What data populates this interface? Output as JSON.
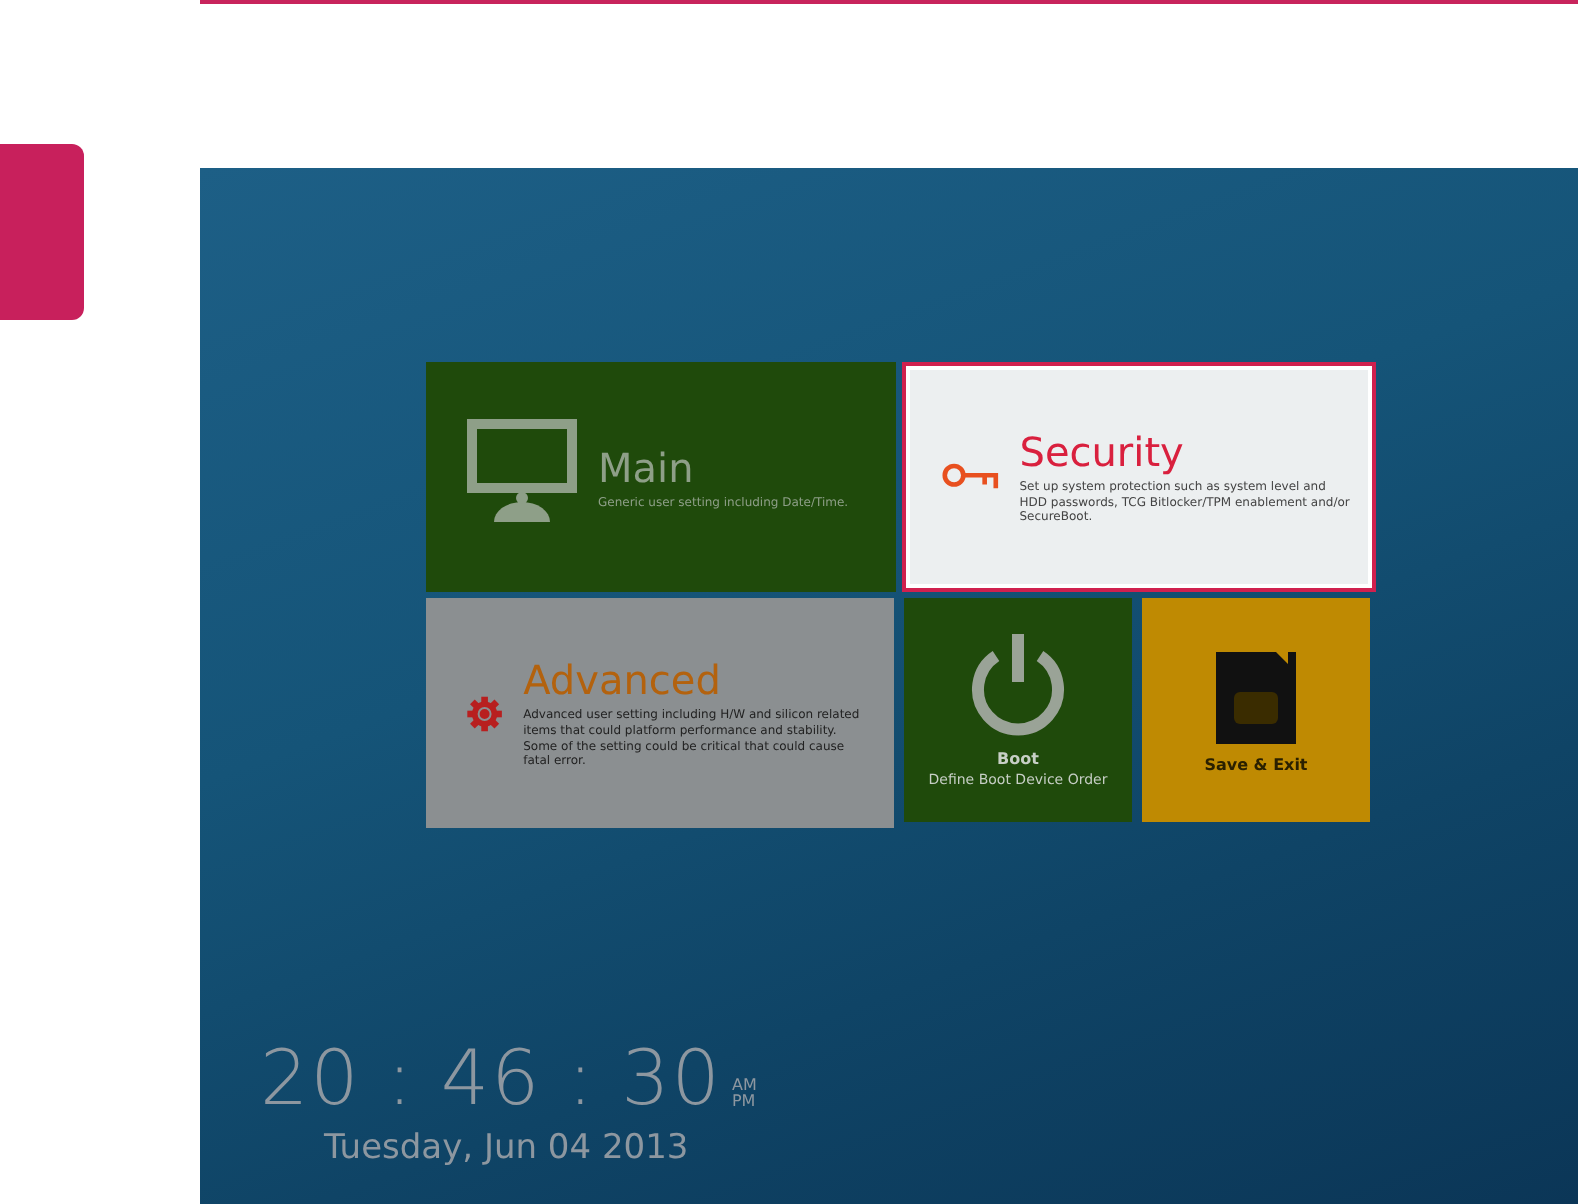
{
  "tiles": [
    {
      "kind": "wide",
      "title": "Main",
      "description": "Generic user setting including Date/Time.",
      "selected": false,
      "color": "#1f4a0b"
    },
    {
      "kind": "wide",
      "title": "Security",
      "description": "Set up system protection such as system level and HDD passwords, TCG Bitlocker/TPM enablement and/or SecureBoot.",
      "selected": true,
      "color": "#eceff0"
    },
    {
      "kind": "wide",
      "title": "Advanced",
      "description": "Advanced user setting including H/W and silicon related items that could platform performance and stability. Some of the setting could be critical that could cause fatal error.",
      "selected": false,
      "color": "#8b8f91"
    },
    {
      "kind": "small",
      "title": "Boot",
      "description": "Define Boot Device Order",
      "selected": false,
      "color": "#1f4a0b"
    },
    {
      "kind": "small",
      "title": "Save & Exit",
      "selected": false,
      "color": "#bf8a02"
    }
  ],
  "clock": {
    "time": "20 : 46 : 30",
    "am": "AM",
    "pm": "PM",
    "date": "Tuesday, Jun 04 2013"
  }
}
